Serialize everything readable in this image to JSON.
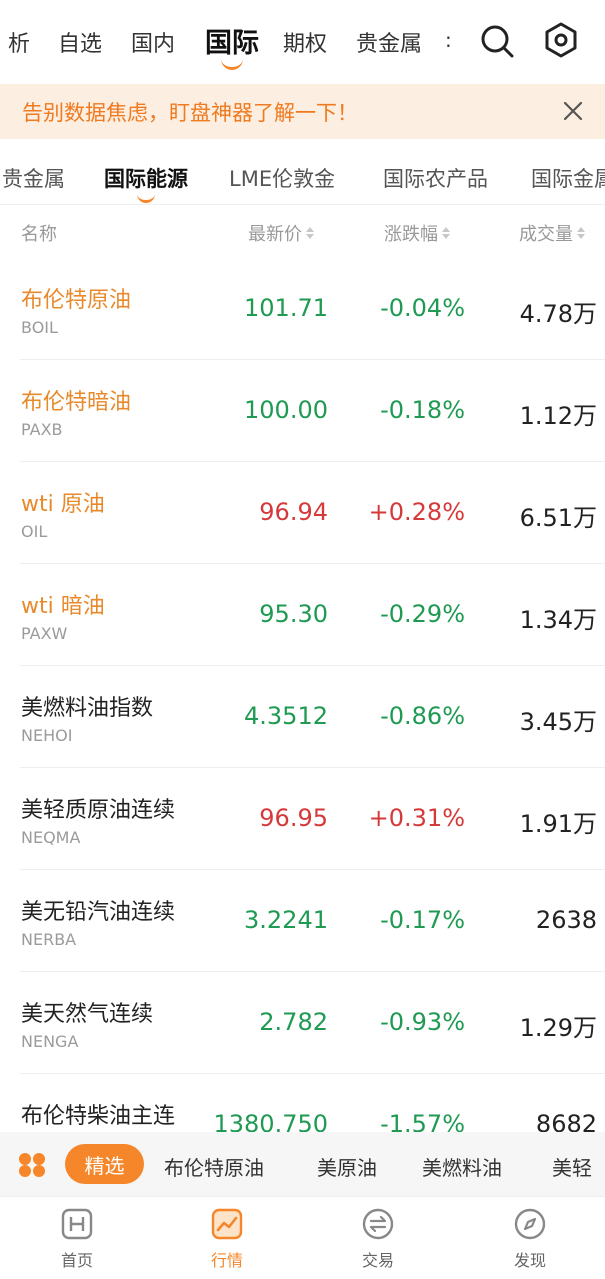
{
  "top_nav": {
    "tabs": [
      {
        "label": "析"
      },
      {
        "label": "自选"
      },
      {
        "label": "国内"
      },
      {
        "label": "国际",
        "active": true
      },
      {
        "label": "期权"
      },
      {
        "label": "贵金属"
      }
    ],
    "overflow_dots": ":",
    "icons": [
      "search-icon",
      "settings-icon"
    ]
  },
  "banner": {
    "text": "告别数据焦虑，盯盘神器了解一下！",
    "close_icon": "close-icon"
  },
  "sub_tabs": [
    {
      "label": "贵金属"
    },
    {
      "label": "国际能源",
      "active": true
    },
    {
      "label": "LME伦敦金"
    },
    {
      "label": "国际农产品"
    },
    {
      "label": "国际金属"
    }
  ],
  "table": {
    "headers": {
      "name": "名称",
      "price": "最新价",
      "change": "涨跌幅",
      "volume": "成交量"
    },
    "rows": [
      {
        "name": "布伦特原油",
        "code": "BOIL",
        "price": "101.71",
        "change": "-0.04%",
        "volume": "4.78万",
        "highlight": true,
        "dir": "down"
      },
      {
        "name": "布伦特暗油",
        "code": "PAXB",
        "price": "100.00",
        "change": "-0.18%",
        "volume": "1.12万",
        "highlight": true,
        "dir": "down"
      },
      {
        "name": "wti 原油",
        "code": "OIL",
        "price": "96.94",
        "change": "+0.28%",
        "volume": "6.51万",
        "highlight": true,
        "dir": "up"
      },
      {
        "name": "wti 暗油",
        "code": "PAXW",
        "price": "95.30",
        "change": "-0.29%",
        "volume": "1.34万",
        "highlight": true,
        "dir": "down"
      },
      {
        "name": "美燃料油指数",
        "code": "NEHOI",
        "price": "4.3512",
        "change": "-0.86%",
        "volume": "3.45万",
        "highlight": false,
        "dir": "down"
      },
      {
        "name": "美轻质原油连续",
        "code": "NEQMA",
        "price": "96.95",
        "change": "+0.31%",
        "volume": "1.91万",
        "highlight": false,
        "dir": "up"
      },
      {
        "name": "美无铅汽油连续",
        "code": "NERBA",
        "price": "3.2241",
        "change": "-0.17%",
        "volume": "2638",
        "highlight": false,
        "dir": "down"
      },
      {
        "name": "美天然气连续",
        "code": "NENGA",
        "price": "2.782",
        "change": "-0.93%",
        "volume": "1.29万",
        "highlight": false,
        "dir": "down"
      },
      {
        "name": "布伦特柴油主连",
        "code": "",
        "price": "1380.750",
        "change": "-1.57%",
        "volume": "8682",
        "highlight": false,
        "dir": "down"
      }
    ]
  },
  "quick_bar": {
    "grid_icon": "grid-icon",
    "selected": "精选",
    "items": [
      "布伦特原油",
      "美原油",
      "美燃料油",
      "美轻"
    ]
  },
  "bottom_nav": [
    {
      "label": "首页",
      "icon": "home-icon"
    },
    {
      "label": "行情",
      "icon": "chart-icon",
      "active": true
    },
    {
      "label": "交易",
      "icon": "exchange-icon"
    },
    {
      "label": "发现",
      "icon": "compass-icon"
    }
  ],
  "colors": {
    "accent": "#f5862a",
    "up": "#d6393a",
    "down": "#1e9a52",
    "highlight_name": "#e88a2c"
  }
}
